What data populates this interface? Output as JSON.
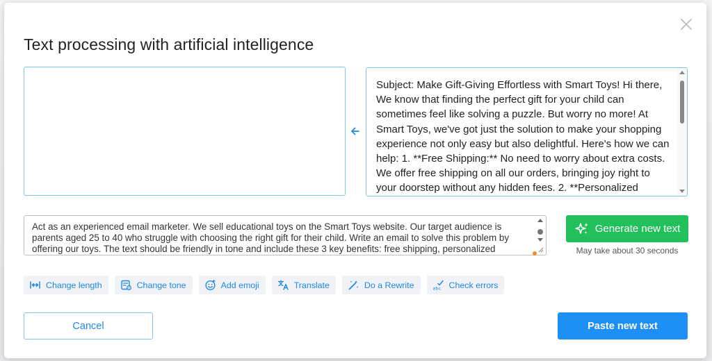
{
  "dialog": {
    "title": "Text processing with artificial intelligence"
  },
  "source": {
    "value": ""
  },
  "result": {
    "text": "Subject: Make Gift-Giving Effortless with Smart Toys! Hi there, We know that finding the perfect gift for your child can sometimes feel like solving a puzzle. But worry no more! At Smart Toys, we've got just the solution to make your shopping experience not only easy but also delightful. Here's how we can help: 1. **Free Shipping:** No need to worry about extra costs. We offer free shipping on all our orders, bringing joy right to your doorstep without any hidden fees. 2. **Personalized"
  },
  "prompt": {
    "text": "Act as an experienced email marketer. We sell educational toys on the Smart Toys website. Our target audience is parents aged 25 to 40 who struggle with choosing the right gift for their child. Write an email to solve this problem by offering our toys. The text should be friendly in tone and include these 3 key benefits: free shipping, personalized"
  },
  "generate": {
    "label": "Generate new text",
    "note": "May take about 30 seconds",
    "icon": "sparkles-icon"
  },
  "tools": [
    {
      "label": "Change length",
      "icon": "arrows-horizontal-icon"
    },
    {
      "label": "Change tone",
      "icon": "tone-settings-icon"
    },
    {
      "label": "Add emoji",
      "icon": "emoji-icon"
    },
    {
      "label": "Translate",
      "icon": "translate-icon"
    },
    {
      "label": "Do a Rewrite",
      "icon": "magic-wand-icon"
    },
    {
      "label": "Check errors",
      "icon": "spellcheck-icon"
    }
  ],
  "footer": {
    "cancel_label": "Cancel",
    "paste_label": "Paste new text"
  },
  "colors": {
    "accent": "#1e88e5",
    "generate": "#22c05a",
    "primary": "#1e90f5",
    "field_border": "#7ec4f4"
  }
}
